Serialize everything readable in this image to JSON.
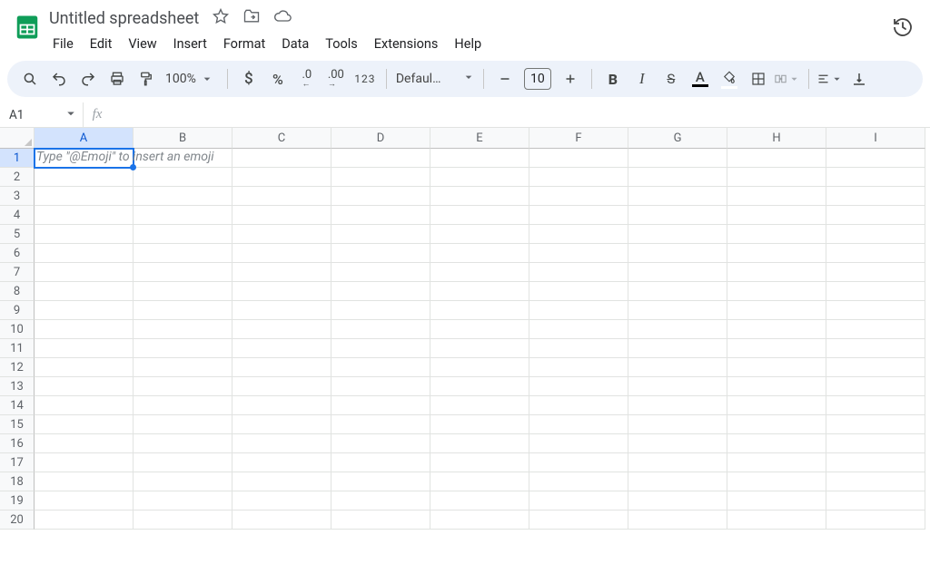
{
  "app": {
    "title": "Untitled spreadsheet"
  },
  "menus": [
    "File",
    "Edit",
    "View",
    "Insert",
    "Format",
    "Data",
    "Tools",
    "Extensions",
    "Help"
  ],
  "toolbar": {
    "zoom": "100%",
    "number_123": "123",
    "font": "Defaul…",
    "font_size": "10",
    "text_color_letter": "A"
  },
  "name_box": "A1",
  "active_cell": {
    "row": 1,
    "col": "A",
    "placeholder": "Type \"@Emoji\" to insert an emoji"
  },
  "columns": [
    "A",
    "B",
    "C",
    "D",
    "E",
    "F",
    "G",
    "H",
    "I"
  ],
  "row_count": 20
}
